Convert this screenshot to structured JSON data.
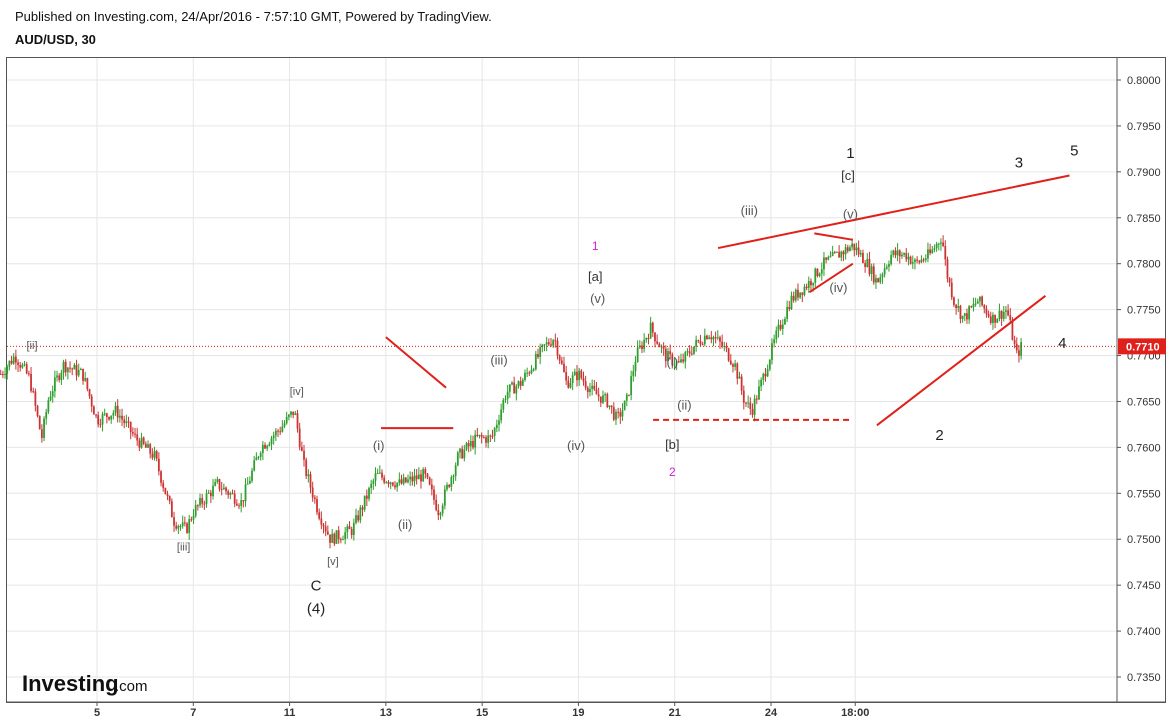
{
  "header": {
    "published": "Published on Investing.com, 24/Apr/2016 - 7:57:10 GMT, Powered by TradingView.",
    "symbol": "AUD/USD, 30"
  },
  "logo": {
    "brand": "Investing",
    "suffix": ".com"
  },
  "colors": {
    "up": "#2e9e2e",
    "down": "#cc3333",
    "annotation": "#e0201a",
    "price_tag": "#e0201a",
    "magenta": "#d21fd2",
    "grid": "#e6e6e6"
  },
  "chart_data": {
    "type": "candlestick",
    "symbol": "AUD/USD",
    "interval": "30",
    "y_axis": {
      "side": "right",
      "ylim": [
        0.732,
        0.801
      ],
      "ticks": [
        "0.8000",
        "0.7950",
        "0.7900",
        "0.7850",
        "0.7800",
        "0.7750",
        "0.7700",
        "0.7650",
        "0.7600",
        "0.7550",
        "0.7500",
        "0.7450",
        "0.7400",
        "0.7350"
      ]
    },
    "x_axis": {
      "ticks": [
        {
          "label": "5",
          "day": 5
        },
        {
          "label": "7",
          "day": 7
        },
        {
          "label": "11",
          "day": 9
        },
        {
          "label": "13",
          "day": 11
        },
        {
          "label": "15",
          "day": 13
        },
        {
          "label": "19",
          "day": 15
        },
        {
          "label": "21",
          "day": 17
        },
        {
          "label": "24",
          "day": 19
        },
        {
          "label": "18:00",
          "day": 20.75
        }
      ]
    },
    "last_price": "0.7710",
    "grid": true,
    "price_path": [
      [
        3.0,
        0.768
      ],
      [
        3.3,
        0.77
      ],
      [
        3.6,
        0.7675
      ],
      [
        3.85,
        0.761
      ],
      [
        4.0,
        0.7655
      ],
      [
        4.3,
        0.769
      ],
      [
        4.7,
        0.768
      ],
      [
        5.0,
        0.763
      ],
      [
        5.4,
        0.764
      ],
      [
        5.8,
        0.761
      ],
      [
        6.2,
        0.759
      ],
      [
        6.6,
        0.752
      ],
      [
        6.85,
        0.751
      ],
      [
        7.0,
        0.753
      ],
      [
        7.5,
        0.756
      ],
      [
        8.0,
        0.754
      ],
      [
        8.4,
        0.76
      ],
      [
        8.8,
        0.762
      ],
      [
        9.1,
        0.764
      ],
      [
        9.3,
        0.758
      ],
      [
        9.6,
        0.753
      ],
      [
        9.85,
        0.75
      ],
      [
        10.3,
        0.751
      ],
      [
        10.8,
        0.757
      ],
      [
        11.3,
        0.756
      ],
      [
        11.8,
        0.757
      ],
      [
        12.1,
        0.753
      ],
      [
        12.5,
        0.759
      ],
      [
        12.9,
        0.761
      ],
      [
        13.2,
        0.761
      ],
      [
        13.5,
        0.766
      ],
      [
        13.8,
        0.767
      ],
      [
        14.05,
        0.769
      ],
      [
        14.3,
        0.771
      ],
      [
        14.5,
        0.772
      ],
      [
        14.75,
        0.767
      ],
      [
        15.0,
        0.768
      ],
      [
        15.3,
        0.766
      ],
      [
        15.6,
        0.765
      ],
      [
        15.8,
        0.763
      ],
      [
        16.0,
        0.765
      ],
      [
        16.2,
        0.77
      ],
      [
        16.5,
        0.773
      ],
      [
        16.8,
        0.77
      ],
      [
        17.1,
        0.769
      ],
      [
        17.4,
        0.771
      ],
      [
        17.7,
        0.7725
      ],
      [
        18.0,
        0.771
      ],
      [
        18.25,
        0.769
      ],
      [
        18.45,
        0.765
      ],
      [
        18.6,
        0.764
      ],
      [
        18.8,
        0.767
      ],
      [
        19.1,
        0.772
      ],
      [
        19.4,
        0.776
      ],
      [
        19.8,
        0.778
      ],
      [
        20.1,
        0.78
      ],
      [
        20.4,
        0.781
      ],
      [
        20.7,
        0.782
      ],
      [
        21.0,
        0.78
      ],
      [
        21.2,
        0.778
      ],
      [
        21.5,
        0.781
      ],
      [
        21.8,
        0.781
      ],
      [
        22.0,
        0.78
      ],
      [
        22.3,
        0.781
      ],
      [
        22.55,
        0.783
      ],
      [
        22.65,
        0.779
      ],
      [
        22.8,
        0.776
      ],
      [
        23.0,
        0.774
      ],
      [
        23.3,
        0.776
      ],
      [
        23.6,
        0.774
      ],
      [
        23.9,
        0.775
      ],
      [
        24.1,
        0.77
      ],
      [
        24.2,
        0.771
      ]
    ],
    "wave_labels": [
      {
        "text": "[ii]",
        "day": 3.65,
        "price": 0.7707,
        "color": "#555",
        "size": 11
      },
      {
        "text": "[iii]",
        "day": 6.8,
        "price": 0.7488,
        "color": "#555",
        "size": 11
      },
      {
        "text": "[iv]",
        "day": 9.15,
        "price": 0.7657,
        "color": "#555",
        "size": 11
      },
      {
        "text": "[v]",
        "day": 9.9,
        "price": 0.7472,
        "color": "#555",
        "size": 11
      },
      {
        "text": "C",
        "day": 9.55,
        "price": 0.7444,
        "color": "#222",
        "size": 15
      },
      {
        "text": "(4)",
        "day": 9.55,
        "price": 0.7419,
        "color": "#222",
        "size": 15
      },
      {
        "text": "(i)",
        "day": 10.85,
        "price": 0.7597,
        "color": "#555",
        "size": 13
      },
      {
        "text": "(ii)",
        "day": 11.4,
        "price": 0.7511,
        "color": "#555",
        "size": 13
      },
      {
        "text": "(iii)",
        "day": 13.35,
        "price": 0.769,
        "color": "#555",
        "size": 13
      },
      {
        "text": "(iv)",
        "day": 14.95,
        "price": 0.7597,
        "color": "#555",
        "size": 13
      },
      {
        "text": "1",
        "day": 15.35,
        "price": 0.7815,
        "color": "#d21fd2",
        "size": 12
      },
      {
        "text": "[a]",
        "day": 15.35,
        "price": 0.7781,
        "color": "#333",
        "size": 13
      },
      {
        "text": "(v)",
        "day": 15.4,
        "price": 0.7757,
        "color": "#555",
        "size": 13
      },
      {
        "text": "(i)",
        "day": 16.95,
        "price": 0.7688,
        "color": "#555",
        "size": 13
      },
      {
        "text": "(ii)",
        "day": 17.2,
        "price": 0.7641,
        "color": "#555",
        "size": 13
      },
      {
        "text": "[b]",
        "day": 16.95,
        "price": 0.7598,
        "color": "#333",
        "size": 13
      },
      {
        "text": "2",
        "day": 16.95,
        "price": 0.7569,
        "color": "#d21fd2",
        "size": 12
      },
      {
        "text": "(iii)",
        "day": 18.55,
        "price": 0.7853,
        "color": "#555",
        "size": 13
      },
      {
        "text": "(iv)",
        "day": 20.4,
        "price": 0.7769,
        "color": "#555",
        "size": 13
      },
      {
        "text": "1",
        "day": 20.65,
        "price": 0.7915,
        "color": "#222",
        "size": 15
      },
      {
        "text": "[c]",
        "day": 20.6,
        "price": 0.7891,
        "color": "#333",
        "size": 13
      },
      {
        "text": "(v)",
        "day": 20.65,
        "price": 0.7849,
        "color": "#555",
        "size": 13
      },
      {
        "text": "2",
        "day": 22.5,
        "price": 0.7608,
        "color": "#222",
        "size": 15
      },
      {
        "text": "3",
        "day": 24.15,
        "price": 0.7905,
        "color": "#222",
        "size": 15
      },
      {
        "text": "4",
        "day": 25.05,
        "price": 0.7708,
        "color": "#222",
        "size": 15
      },
      {
        "text": "5",
        "day": 25.3,
        "price": 0.7918,
        "color": "#222",
        "size": 15
      }
    ],
    "trend_lines": [
      {
        "x1": 11.0,
        "y1": 0.772,
        "x2": 12.25,
        "y2": 0.7665
      },
      {
        "x1": 10.9,
        "y1": 0.7621,
        "x2": 12.4,
        "y2": 0.7621
      },
      {
        "x1": 17.9,
        "y1": 0.7817,
        "x2": 25.2,
        "y2": 0.7896
      },
      {
        "x1": 19.9,
        "y1": 0.7833,
        "x2": 20.7,
        "y2": 0.7826
      },
      {
        "x1": 19.8,
        "y1": 0.7769,
        "x2": 20.7,
        "y2": 0.78
      },
      {
        "x1": 21.2,
        "y1": 0.7624,
        "x2": 24.7,
        "y2": 0.7765
      }
    ],
    "dashed_lines": [
      {
        "x1": 16.55,
        "y1": 0.763,
        "x2": 20.65,
        "y2": 0.763
      }
    ]
  }
}
